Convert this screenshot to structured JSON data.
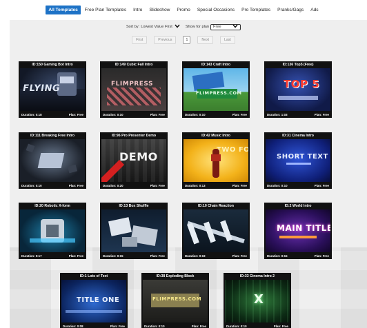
{
  "nav": {
    "tabs": [
      {
        "label": "All Templates",
        "active": true
      },
      {
        "label": "Free Plan Templates",
        "active": false
      },
      {
        "label": "Intro",
        "active": false
      },
      {
        "label": "Slideshow",
        "active": false
      },
      {
        "label": "Promo",
        "active": false
      },
      {
        "label": "Special Occasions",
        "active": false
      },
      {
        "label": "Pro Templates",
        "active": false
      },
      {
        "label": "Pranks/Gags",
        "active": false
      },
      {
        "label": "Ads",
        "active": false
      }
    ]
  },
  "controls": {
    "sort_label": "Sort by:",
    "sort_value": "Lowest Value First",
    "plan_label": "Show for plan",
    "plan_value": "Free"
  },
  "pager": {
    "first": "First",
    "previous": "Previous",
    "current": "1",
    "next": "Next",
    "last": "Last"
  },
  "colors": {
    "accent": "#1d72c6",
    "card_bg": "#111111",
    "panel_bg": "#efefef"
  },
  "cards": [
    {
      "title": "ID:150 Gaming Bot Intro",
      "duration": "Duration: 0:18",
      "plan": "Plan: Free",
      "thumb_text": "FLYING"
    },
    {
      "title": "ID:149 Cubic Fall Intro",
      "duration": "Duration: 0:10",
      "plan": "Plan: Free",
      "thumb_text": "FLIMPRESS"
    },
    {
      "title": "ID:143 Craft Intro",
      "duration": "Duration: 0:10",
      "plan": "Plan: Free",
      "thumb_text": "FLIMPRESS.COM"
    },
    {
      "title": "ID:136 Top5 (Free)",
      "duration": "Duration: 1:03",
      "plan": "Plan: Free",
      "thumb_text": "TOP 5"
    },
    {
      "title": "ID:111 Breaking Free Intro",
      "duration": "Duration: 0:10",
      "plan": "Plan: Free",
      "thumb_text": ""
    },
    {
      "title": "ID:96 Pro Presenter Demo",
      "duration": "Duration: 0:20",
      "plan": "Plan: Free",
      "thumb_text": "DEMO"
    },
    {
      "title": "ID:42 Music Intro",
      "duration": "Duration: 0:13",
      "plan": "Plan: Free",
      "thumb_text": "TWO FOUR"
    },
    {
      "title": "ID:31 Cinema Intro",
      "duration": "Duration: 0:10",
      "plan": "Plan: Free",
      "thumb_text": "SHORT TEXT"
    },
    {
      "title": "ID:20 Robotic X-form",
      "duration": "Duration: 0:17",
      "plan": "Plan: Free",
      "thumb_text": ""
    },
    {
      "title": "ID:13 Box Shuffle",
      "duration": "Duration: 0:15",
      "plan": "Plan: Free",
      "thumb_text": ""
    },
    {
      "title": "ID:10 Chain Reaction",
      "duration": "Duration: 0:19",
      "plan": "Plan: Free",
      "thumb_text": ""
    },
    {
      "title": "ID:2 World Intro",
      "duration": "Duration: 0:15",
      "plan": "Plan: Free",
      "thumb_text": "MAIN TITLE"
    },
    {
      "title": "ID:1 Lots of Text",
      "duration": "Duration: 0:08",
      "plan": "Plan: Free",
      "thumb_text": "TITLE ONE"
    },
    {
      "title": "ID:38 Exploding Block",
      "duration": "Duration: 0:10",
      "plan": "Plan: Free",
      "thumb_text": "FLIMPRESS.COM"
    },
    {
      "title": "ID:33 Cinema Intro 2",
      "duration": "Duration: 0:10",
      "plan": "Plan: Free",
      "thumb_text": "X"
    }
  ]
}
